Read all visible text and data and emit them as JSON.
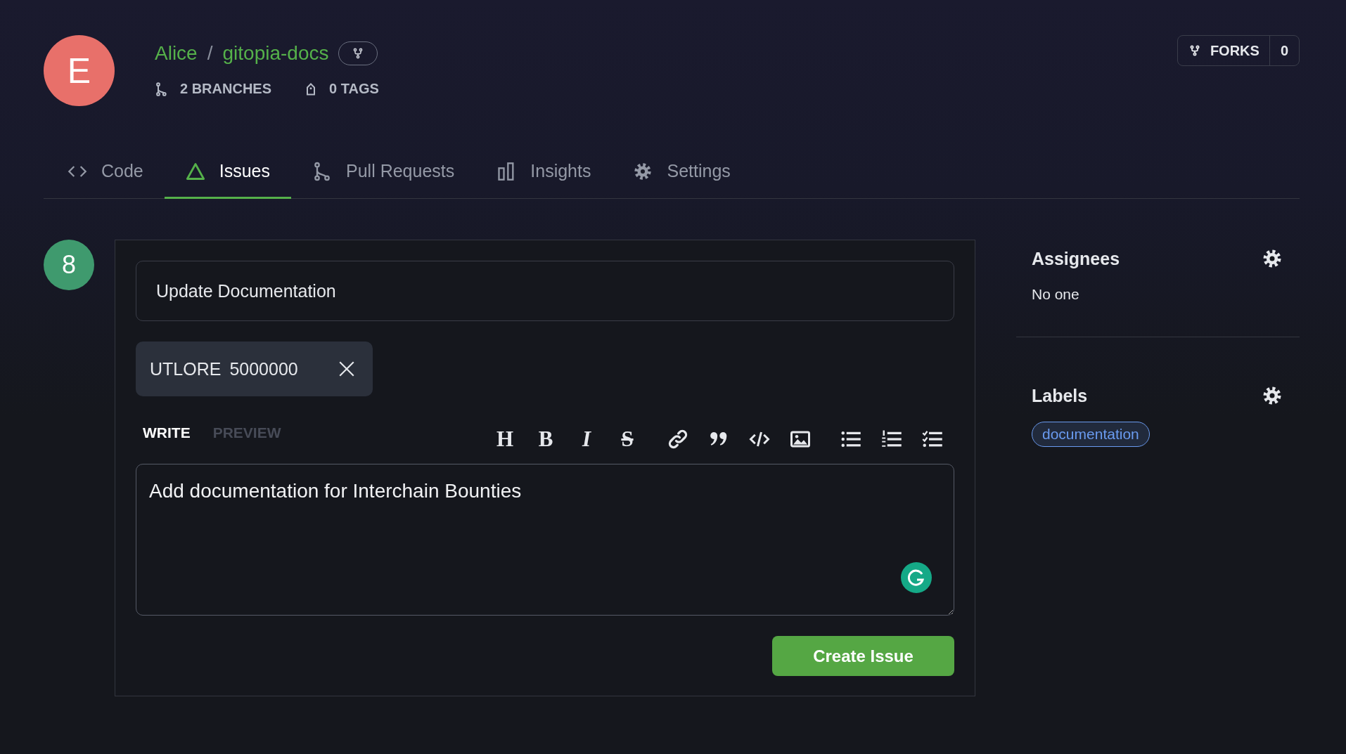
{
  "repo": {
    "avatar_letter": "E",
    "owner": "Alice",
    "separator": "/",
    "name": "gitopia-docs",
    "branches": "2 BRANCHES",
    "tags": "0 TAGS"
  },
  "forks": {
    "label": "FORKS",
    "count": "0"
  },
  "tabs": [
    {
      "label": "Code",
      "kind": "code",
      "selected": false
    },
    {
      "label": "Issues",
      "kind": "issues",
      "selected": true
    },
    {
      "label": "Pull Requests",
      "kind": "pulls",
      "selected": false
    },
    {
      "label": "Insights",
      "kind": "insights",
      "selected": false
    },
    {
      "label": "Settings",
      "kind": "settings",
      "selected": false
    }
  ],
  "issue": {
    "number": "8",
    "title": "Update Documentation",
    "bounty": {
      "denom": "UTLORE",
      "amount": "5000000"
    },
    "editor_tabs": [
      {
        "label": "WRITE",
        "selected": true
      },
      {
        "label": "PREVIEW",
        "selected": false
      }
    ],
    "toolbar_groups": [
      [
        {
          "kind": "heading",
          "glyph": "H"
        },
        {
          "kind": "bold",
          "glyph": "B"
        },
        {
          "kind": "italic",
          "glyph": "I"
        },
        {
          "kind": "strike",
          "glyph": "S"
        }
      ],
      [
        {
          "kind": "link"
        },
        {
          "kind": "quote"
        },
        {
          "kind": "code"
        },
        {
          "kind": "image"
        }
      ],
      [
        {
          "kind": "bullets"
        },
        {
          "kind": "numbers"
        },
        {
          "kind": "tasks"
        }
      ]
    ],
    "body": "Add documentation for Interchain Bounties",
    "submit": "Create Issue"
  },
  "sidebar": {
    "assignees": {
      "title": "Assignees",
      "value": "No one"
    },
    "labels": {
      "title": "Labels",
      "items": [
        {
          "name": "documentation",
          "color": "#6a9bf0"
        }
      ]
    }
  }
}
